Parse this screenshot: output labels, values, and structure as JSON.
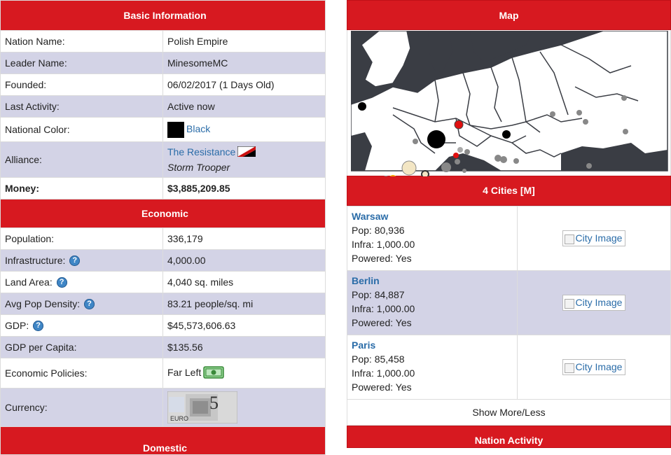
{
  "basic": {
    "header": "Basic Information",
    "rows": {
      "nation_name": {
        "label": "Nation Name:",
        "value": "Polish Empire"
      },
      "leader_name": {
        "label": "Leader Name:",
        "value": "MinesomeMC"
      },
      "founded": {
        "label": "Founded:",
        "value": "06/02/2017 (1 Days Old)"
      },
      "last_activity": {
        "label": "Last Activity:",
        "value": "Active now"
      },
      "national_color": {
        "label": "National Color:",
        "value": "Black"
      },
      "alliance": {
        "label": "Alliance:",
        "value": "The Resistance",
        "position": "Storm Trooper"
      },
      "money": {
        "label": "Money:",
        "value": "$3,885,209.85"
      }
    }
  },
  "economic": {
    "header": "Economic",
    "rows": {
      "population": {
        "label": "Population:",
        "value": "336,179"
      },
      "infrastructure": {
        "label": "Infrastructure:",
        "value": "4,000.00"
      },
      "land_area": {
        "label": "Land Area:",
        "value": "4,040 sq. miles"
      },
      "density": {
        "label": "Avg Pop Density:",
        "value": "83.21 people/sq. mi"
      },
      "gdp": {
        "label": "GDP:",
        "value": "$45,573,606.63"
      },
      "gdp_capita": {
        "label": "GDP per Capita:",
        "value": "$135.56"
      },
      "policies": {
        "label": "Economic Policies:",
        "value": "Far Left"
      },
      "currency": {
        "label": "Currency:",
        "note_text": "5",
        "note_small": "EURO"
      }
    }
  },
  "domestic": {
    "header": "Domestic"
  },
  "help_glyph": "?",
  "map": {
    "header": "Map"
  },
  "cities": {
    "header": "4 Cities [M]",
    "image_alt": "City Image",
    "items": [
      {
        "name": "Warsaw",
        "pop": "Pop: 80,936",
        "infra": "Infra: 1,000.00",
        "powered": "Powered: Yes"
      },
      {
        "name": "Berlin",
        "pop": "Pop: 84,887",
        "infra": "Infra: 1,000.00",
        "powered": "Powered: Yes"
      },
      {
        "name": "Paris",
        "pop": "Pop: 85,458",
        "infra": "Infra: 1,000.00",
        "powered": "Powered: Yes"
      }
    ],
    "show_more": "Show More/Less"
  },
  "activity": {
    "header": "Nation Activity"
  },
  "colors": {
    "header_red": "#d71920",
    "alt_row": "#d3d3e6",
    "link": "#2a6ca8",
    "land": "#ffffff",
    "sea": "#3a3d44"
  }
}
